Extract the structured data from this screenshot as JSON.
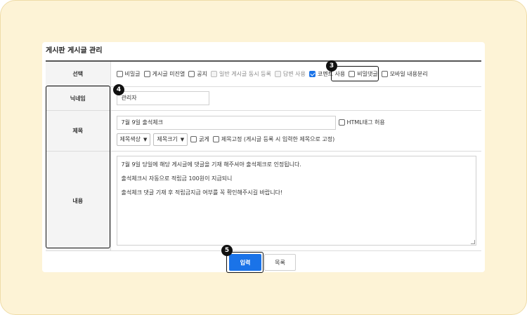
{
  "page": {
    "title": "게시판 게시글 관리"
  },
  "form": {
    "select": {
      "label": "선택",
      "options": [
        {
          "label": "비밀글",
          "checked": false,
          "disabled": false
        },
        {
          "label": "게시글 미진열",
          "checked": false,
          "disabled": false
        },
        {
          "label": "공지",
          "checked": false,
          "disabled": false
        },
        {
          "label": "일반 게시글 동시 등록",
          "checked": false,
          "disabled": true
        },
        {
          "label": "답변 사용",
          "checked": false,
          "disabled": true
        },
        {
          "label": "코멘트 사용",
          "checked": true,
          "disabled": false
        },
        {
          "label": "비밀댓글",
          "checked": false,
          "disabled": false
        },
        {
          "label": "모바일 내용분리",
          "checked": false,
          "disabled": false
        }
      ]
    },
    "nickname": {
      "label": "닉네임",
      "value": "관리자"
    },
    "subject": {
      "label": "제목",
      "value": "7월 9일 출석체크",
      "html_allow_label": "HTML태그 허용",
      "color_select": "제목색상",
      "size_select": "제목크기",
      "bold_label": "굵게",
      "fixed_label": "제목고정 (게시글 등록 시 입력한 제목으로 고정)"
    },
    "content": {
      "label": "내용",
      "lines": [
        "7월 9일 당일에 해당 게시글에 댓글을 기재 해주셔야 출석체크로 인정됩니다.",
        "출석체크시 자동으로 적립금 100원이 지급되니",
        "출석체크 댓글 기재 후 적립금지급 여부를 꼭 확인해주시길 바랍니다!"
      ]
    }
  },
  "buttons": {
    "submit": "입력",
    "list": "목록"
  },
  "callouts": {
    "c3": "3",
    "c4": "4",
    "c5": "5"
  },
  "colors": {
    "accent": "#1a73e8",
    "frame": "#fdf3d6",
    "highlight": "#111111"
  }
}
